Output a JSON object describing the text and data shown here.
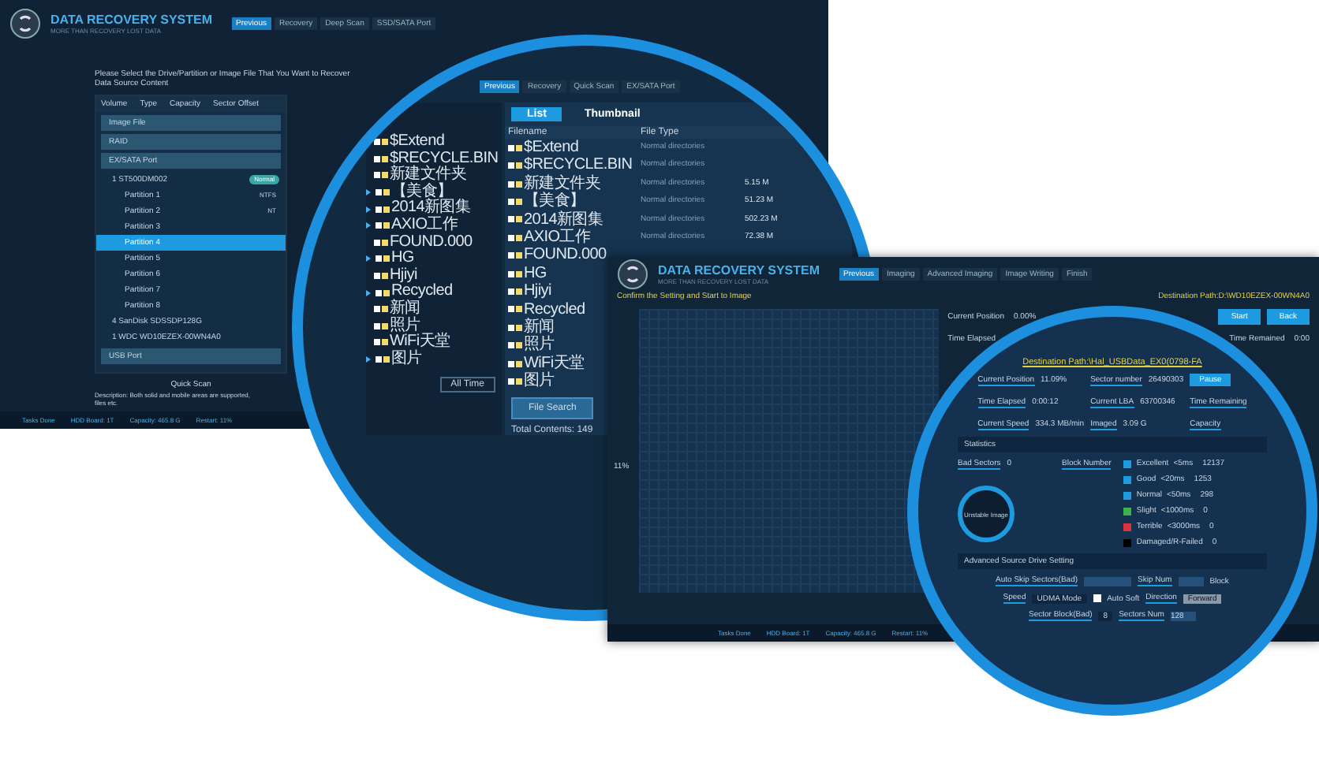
{
  "back_window": {
    "title": "DATA RECOVERY SYSTEM",
    "subtitle": "MORE THAN RECOVERY LOST DATA",
    "breadcrumb": [
      "Previous",
      "Recovery",
      "Deep Scan",
      "SSD/SATA Port"
    ],
    "instruction": "Please Select the Drive/Partition or Image File That You Want to Recover",
    "section": "Data Source Content",
    "columns": [
      "Volume",
      "Type",
      "Capacity",
      "Sector Offset"
    ],
    "sources": [
      {
        "label": "Image File",
        "selected": false
      },
      {
        "label": "RAID",
        "selected": false
      },
      {
        "label": "EX/SATA Port",
        "selected": false,
        "children": [
          {
            "label": "1 ST500DM002",
            "selected": false,
            "badge": "Normal",
            "children": [
              {
                "label": "Partition 1",
                "selected": false,
                "type": "NTFS"
              },
              {
                "label": "Partition 2",
                "selected": false,
                "type": "NT"
              },
              {
                "label": "Partition 3",
                "selected": false
              },
              {
                "label": "Partition 4",
                "selected": true
              },
              {
                "label": "Partition 5",
                "selected": false
              },
              {
                "label": "Partition 6",
                "selected": false
              },
              {
                "label": "Partition 7",
                "selected": false
              },
              {
                "label": "Partition 8",
                "selected": false
              }
            ]
          },
          {
            "label": "4 SanDisk SDSSDP128G",
            "selected": false
          },
          {
            "label": "1 WDC WD10EZEX-00WN4A0",
            "selected": false
          }
        ]
      },
      {
        "label": "USB Port",
        "selected": false
      }
    ],
    "quick_scan": "Quick Scan",
    "description": "Description: Both solid and mobile areas are supported,",
    "description_2": "files etc.",
    "status": [
      "Tasks Done",
      "HDD Board: 1T",
      "Capacity: 465.8 G",
      "Restart: 11%"
    ]
  },
  "zoom_file_list": {
    "breadcrumb": [
      "Previous",
      "Recovery",
      "Quick Scan",
      "EX/SATA Port"
    ],
    "folders": [
      {
        "name": "$Extend",
        "expandable": false
      },
      {
        "name": "$RECYCLE.BIN",
        "expandable": false
      },
      {
        "name": "新建文件夹",
        "expandable": false
      },
      {
        "name": "【美食】",
        "expandable": true
      },
      {
        "name": "2014新图集",
        "expandable": true
      },
      {
        "name": "AXIO工作",
        "expandable": true
      },
      {
        "name": "FOUND.000",
        "expandable": false
      },
      {
        "name": "HG",
        "expandable": true
      },
      {
        "name": "Hjiyi",
        "expandable": false
      },
      {
        "name": "Recycled",
        "expandable": true
      },
      {
        "name": "新闻",
        "expandable": false
      },
      {
        "name": "照片",
        "expandable": false
      },
      {
        "name": "WiFi天堂",
        "expandable": false
      },
      {
        "name": "图片",
        "expandable": true
      }
    ],
    "tabs": [
      {
        "label": "List",
        "selected": true
      },
      {
        "label": "Thumbnail",
        "selected": false
      }
    ],
    "columns": [
      "Filename",
      "File Type"
    ],
    "rows": [
      {
        "name": "$Extend",
        "type": "Normal directories"
      },
      {
        "name": "$RECYCLE.BIN",
        "type": "Normal directories"
      },
      {
        "name": "新建文件夹",
        "type": "Normal directories",
        "size": "5.15 M"
      },
      {
        "name": "【美食】",
        "type": "Normal directories",
        "size": "51.23 M"
      },
      {
        "name": "2014新图集",
        "type": "Normal directories",
        "size": "502.23 M"
      },
      {
        "name": "AXIO工作",
        "type": "Normal directories",
        "size": "72.38 M"
      },
      {
        "name": "FOUND.000"
      },
      {
        "name": "HG"
      },
      {
        "name": "Hjiyi"
      },
      {
        "name": "Recycled"
      },
      {
        "name": "新闻"
      },
      {
        "name": "照片"
      },
      {
        "name": "WiFi天堂"
      },
      {
        "name": "图片"
      }
    ],
    "file_search": "File Search",
    "all_time": "All Time",
    "total": "Total Contents: 149"
  },
  "front_window": {
    "title": "DATA RECOVERY SYSTEM",
    "subtitle": "MORE THAN RECOVERY LOST DATA",
    "breadcrumb": [
      "Previous",
      "Imaging",
      "Advanced Imaging",
      "Image Writing",
      "Finish"
    ],
    "instruction": "Confirm the Setting and Start to Image",
    "destination": "Destination Path:D:\\WD10EZEX-00WN4A0",
    "progress_label": "11%",
    "current_position": {
      "label": "Current Position",
      "value": "0.00%"
    },
    "time_elapsed": {
      "label": "Time Elapsed"
    },
    "time_remained": {
      "label": "Time Remained",
      "value": "0:00"
    },
    "buttons": [
      "Start",
      "Back"
    ],
    "status": [
      "Tasks Done",
      "HDD Board: 1T",
      "Capacity: 465.8 G",
      "Restart: 11%"
    ]
  },
  "zoom_imaging": {
    "destination": "Destination Path:\\Hal_USBData_EX0(0798-FA",
    "stats": [
      {
        "label": "Current Position",
        "value": "11.09%"
      },
      {
        "label": "Sector number",
        "value": "26490303"
      },
      {
        "label": "Time Elapsed",
        "value": "0:00:12"
      },
      {
        "label": "Current LBA",
        "value": "63700346"
      },
      {
        "label": "Time Remaining"
      },
      {
        "label": "Current Speed",
        "value": "334.3 MB/min"
      },
      {
        "label": "Imaged",
        "value": "3.09 G"
      },
      {
        "label": "Capacity"
      }
    ],
    "pause": "Pause",
    "statistics": "Statistics",
    "bad_sectors_label": "Bad Sectors",
    "bad_sectors": "0",
    "block_number": "Block Number",
    "legend": [
      {
        "label": "Excellent",
        "limit": "<5ms",
        "count": "12137",
        "color": "#1e9be0"
      },
      {
        "label": "Good",
        "limit": "<20ms",
        "count": "1253",
        "color": "#1e9be0"
      },
      {
        "label": "Normal",
        "limit": "<50ms",
        "count": "298",
        "color": "#1e9be0"
      },
      {
        "label": "Slight",
        "limit": "<1000ms",
        "count": "0",
        "color": "#3cb34a"
      },
      {
        "label": "Terrible",
        "limit": "<3000ms",
        "count": "0",
        "color": "#d8343c"
      },
      {
        "label": "Damaged/R-Failed",
        "count": "0",
        "color": "#000000"
      }
    ],
    "gauge": "Unstable Image",
    "advanced": "Advanced Source Drive Setting",
    "auto_skip": "Auto Skip Sectors(Bad)",
    "skip_num": "Skip Num",
    "block": "Block",
    "speed": "Speed",
    "speed_mode": "UDMA Mode",
    "auto_soft": {
      "label": "Auto Soft",
      "checked": false
    },
    "direction": "Direction",
    "direction_value": "Forward",
    "sector_block": "Sector Block(Bad)",
    "sector_block_value": "8",
    "sectors_num": "Sectors Num",
    "sectors_num_value": "128"
  }
}
